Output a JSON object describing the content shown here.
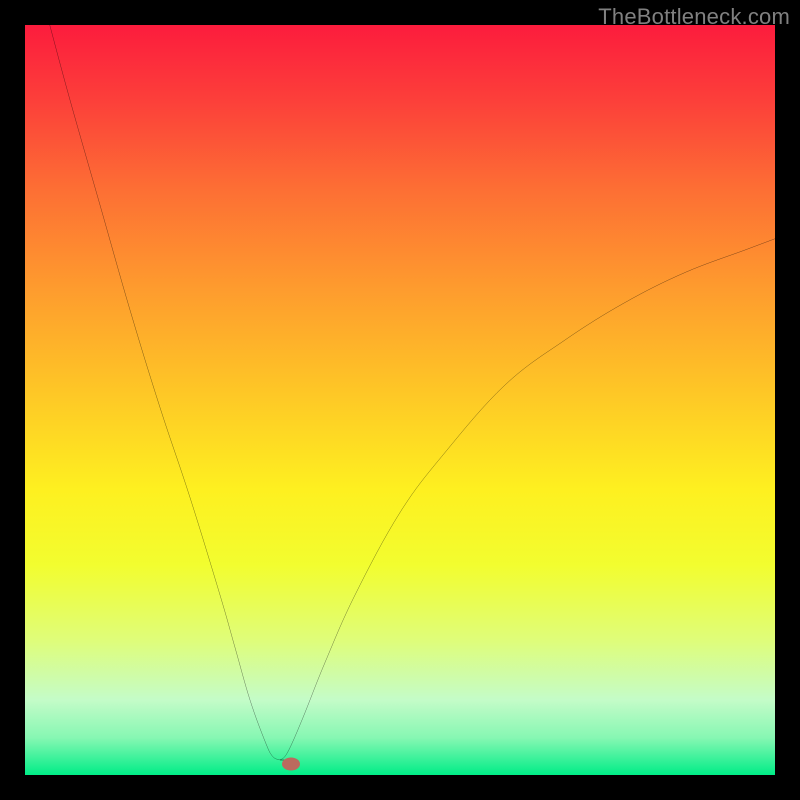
{
  "watermark": "TheBottleneck.com",
  "colors": {
    "page_bg": "#000000",
    "watermark_text": "#808080",
    "curve_stroke": "#000000",
    "marker_fill": "#bb6a5e",
    "gradient_stops": [
      "#fc1c3d",
      "#fc3f3a",
      "#fd6f34",
      "#fe9b2e",
      "#fec726",
      "#fef020",
      "#f2fd2f",
      "#dffd79",
      "#c4fcc8",
      "#87f7b3",
      "#00ed87"
    ]
  },
  "chart_data": {
    "type": "line",
    "title": "",
    "xlabel": "",
    "ylabel": "",
    "xlim": [
      0,
      100
    ],
    "ylim": [
      0,
      100
    ],
    "grid": false,
    "legend": false,
    "series": [
      {
        "name": "left-branch",
        "x": [
          3.3,
          6,
          10,
          14,
          18,
          22,
          26,
          28,
          30,
          32,
          33,
          34
        ],
        "y": [
          100,
          90,
          76,
          62,
          49,
          37,
          24,
          17,
          10,
          4.5,
          2.5,
          2
        ]
      },
      {
        "name": "right-branch",
        "x": [
          34,
          35,
          37,
          40,
          44,
          50,
          56,
          64,
          72,
          80,
          88,
          96,
          100
        ],
        "y": [
          2,
          3,
          7.5,
          15,
          24,
          35,
          43,
          52,
          58,
          63,
          67,
          70,
          71.5
        ]
      }
    ],
    "notch": {
      "x": 34,
      "y": 2
    },
    "marker": {
      "x": 35.5,
      "y": 1.5
    }
  }
}
